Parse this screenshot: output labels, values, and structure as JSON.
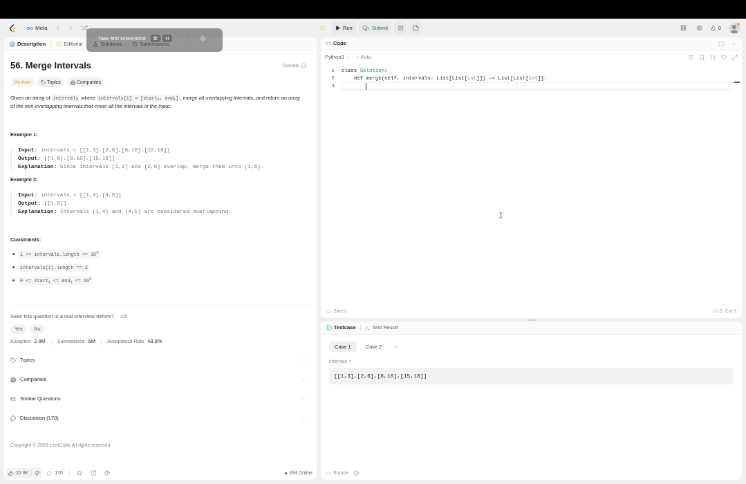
{
  "nav": {
    "list": "Meta"
  },
  "toolbar": {
    "run": "Run",
    "submit": "Submit",
    "streak": "0"
  },
  "screenshot_toolbar": {
    "label": "Take first screenshot",
    "keys": [
      "⌘",
      "H"
    ]
  },
  "description_panel": {
    "tabs": [
      {
        "label": "Description",
        "kind": "description",
        "selected": true
      },
      {
        "label": "Editorial",
        "kind": "editorial",
        "selected": false
      },
      {
        "label": "Solutions",
        "kind": "solutions",
        "selected": false
      },
      {
        "label": "Submissions",
        "kind": "submissions",
        "selected": false
      }
    ],
    "title": "56. Merge Intervals",
    "status": "Solved",
    "difficulty": "Medium",
    "tags": [
      {
        "label": "Topics",
        "kind": "topics"
      },
      {
        "label": "Companies",
        "kind": "companies"
      }
    ],
    "statement": [
      {
        "kind": "text",
        "text": "Given an array of "
      },
      {
        "kind": "code",
        "text": "intervals"
      },
      {
        "kind": "text",
        "text": " where "
      },
      {
        "kind": "code",
        "text": "intervals[i] = [start$_{i}$, end$_{i}$]"
      },
      {
        "kind": "text",
        "text": ", merge all overlapping intervals, and return *an array of the non-overlapping intervals that cover all the intervals in the input.*"
      }
    ],
    "examples": [
      {
        "title": "Example 1:",
        "lines": [
          {
            "label": "Input:",
            "value": "intervals = [[1,3],[2,6],[8,10],[15,18]]"
          },
          {
            "label": "Output:",
            "value": "[[1,6],[8,10],[15,18]]"
          },
          {
            "label": "Explanation:",
            "value": "Since intervals [1,3] and [2,6] overlap, merge them into [1,6]."
          }
        ]
      },
      {
        "title": "Example 2:",
        "lines": [
          {
            "label": "Input:",
            "value": "intervals = [[1,4],[4,5]]"
          },
          {
            "label": "Output:",
            "value": "[[1,5]]"
          },
          {
            "label": "Explanation:",
            "value": "Intervals [1,4] and [4,5] are considered overlapping."
          }
        ]
      }
    ],
    "constraints": {
      "title": "Constraints:",
      "items": [
        "1 <= intervals.length <= 10$^{4}$",
        "intervals[i].length == 2",
        "0 <= start$_{i}$ <= end$_{i}$ <= 10$^{4}$"
      ]
    },
    "interview": {
      "question": "Seen this question in a real interview before?",
      "count": "1/5",
      "answers": [
        "Yes",
        "No"
      ]
    },
    "stats": [
      {
        "label": "Accepted",
        "value": "2.9M"
      },
      {
        "label": "Submissions",
        "value": "6M"
      },
      {
        "label": "Acceptance Rate",
        "value": "48.8%"
      }
    ],
    "sections": [
      {
        "label": "Topics",
        "kind": "topics",
        "expanded": false
      },
      {
        "label": "Companies",
        "kind": "companies",
        "expanded": false
      },
      {
        "label": "Similar Questions",
        "kind": "similar",
        "expanded": false
      },
      {
        "label": "Discussion (170)",
        "kind": "discussion",
        "expanded": false
      }
    ],
    "copyright": "Copyright © 2025 LeetCode All rights reserved",
    "footer": {
      "likes": "22.9K",
      "comments": "170",
      "online": "294 Online"
    }
  },
  "code_panel": {
    "title": "Code",
    "language": "Python3",
    "mode": "Auto",
    "lines": [
      {
        "number": "1",
        "current": false,
        "tokens": [
          {
            "text": "class ",
            "kind": "keyword"
          },
          {
            "text": "Solution",
            "kind": "class"
          },
          {
            "text": ":",
            "kind": "plain"
          }
        ]
      },
      {
        "number": "2",
        "current": false,
        "tokens": [
          {
            "text": "    def ",
            "kind": "keyword"
          },
          {
            "text": "merge",
            "kind": "function"
          },
          {
            "text": "(self, intervals: List[List[",
            "kind": "plain"
          },
          {
            "text": "int",
            "kind": "type"
          },
          {
            "text": "]]) -> List[List[",
            "kind": "plain"
          },
          {
            "text": "int",
            "kind": "type"
          },
          {
            "text": "]]:",
            "kind": "plain"
          }
        ]
      },
      {
        "number": "3",
        "current": true
      }
    ],
    "status": "Saved",
    "position": "Ln 3, Col 9"
  },
  "testcase_panel": {
    "tabs": [
      {
        "label": "Testcase",
        "kind": "testcase",
        "selected": true
      },
      {
        "label": "Test Result",
        "kind": "result",
        "selected": false
      }
    ],
    "cases": [
      {
        "label": "Case 1",
        "selected": true
      },
      {
        "label": "Case 2",
        "selected": false
      }
    ],
    "inputs": [
      {
        "name": "intervals =",
        "value": "[[1,3],[2,6],[8,10],[15,18]]"
      }
    ],
    "source": "Source"
  }
}
